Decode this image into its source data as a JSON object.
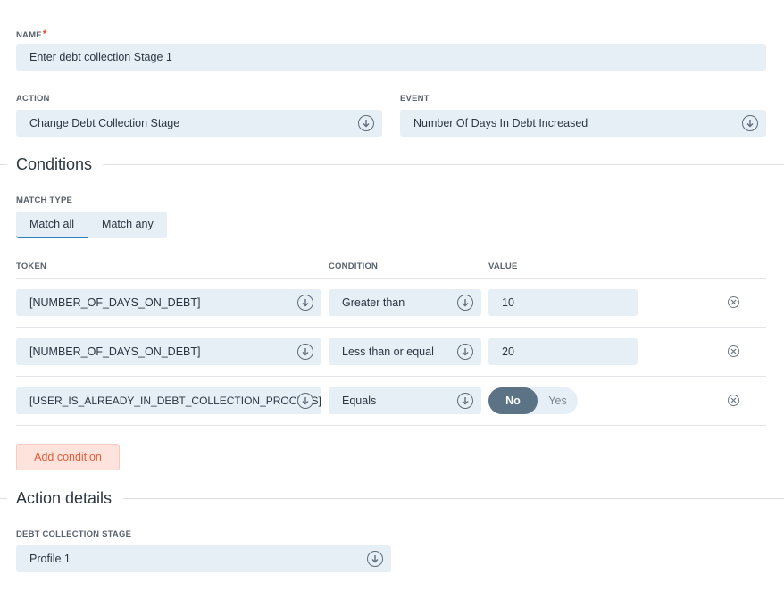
{
  "name": {
    "label": "NAME",
    "required_mark": "*",
    "value": "Enter debt collection Stage 1"
  },
  "action": {
    "label": "ACTION",
    "value": "Change Debt Collection Stage",
    "icon": "arrow-down-circle-icon"
  },
  "event": {
    "label": "EVENT",
    "value": "Number Of Days In Debt Increased",
    "icon": "arrow-down-circle-icon"
  },
  "conditions": {
    "title": "Conditions",
    "match_type_label": "MATCH TYPE",
    "match_options": [
      "Match all",
      "Match any"
    ],
    "selected_match": "Match all",
    "headers": {
      "token": "TOKEN",
      "condition": "CONDITION",
      "value": "VALUE"
    },
    "rows": [
      {
        "token": "[NUMBER_OF_DAYS_ON_DEBT]",
        "condition": "Greater than",
        "value": "10"
      },
      {
        "token": "[NUMBER_OF_DAYS_ON_DEBT]",
        "condition": "Less than or equal",
        "value": "20"
      },
      {
        "token": "[USER_IS_ALREADY_IN_DEBT_COLLECTION_PROCESS]",
        "condition": "Equals",
        "toggle": {
          "on": "No",
          "off": "Yes",
          "selected": "No"
        }
      }
    ],
    "add_label": "Add condition"
  },
  "action_details": {
    "title": "Action details",
    "stage_label": "DEBT COLLECTION STAGE",
    "stage_value": "Profile 1"
  },
  "colors": {
    "accent": "#2b7fbf",
    "field_bg": "#e6eef6",
    "toggle_on": "#5c7386",
    "add_button": "#e2603c"
  }
}
